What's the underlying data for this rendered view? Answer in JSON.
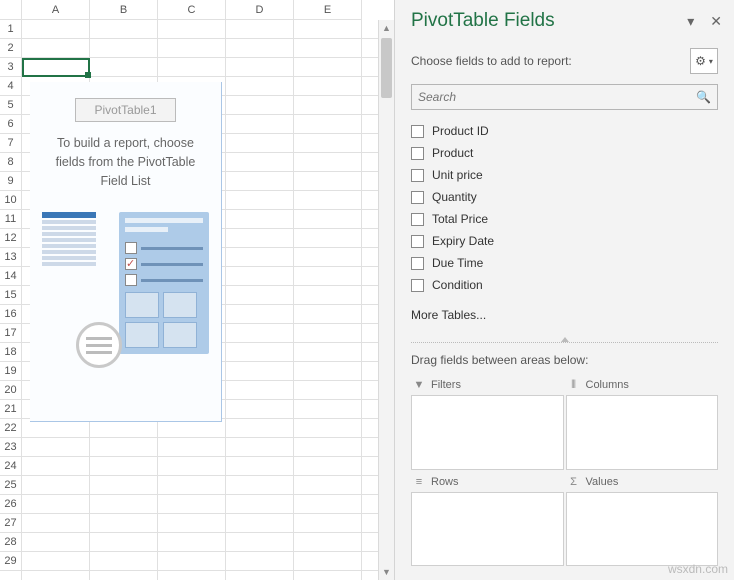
{
  "sheet": {
    "columns": [
      "A",
      "B",
      "C",
      "D",
      "E"
    ],
    "rows_visible": 29,
    "pivot": {
      "name": "PivotTable1",
      "hint": "To build a report, choose fields from the PivotTable Field List"
    }
  },
  "pane": {
    "title": "PivotTable Fields",
    "prompt": "Choose fields to add to report:",
    "search": {
      "placeholder": "Search"
    },
    "fields": [
      {
        "label": "Product ID"
      },
      {
        "label": "Product"
      },
      {
        "label": "Unit price"
      },
      {
        "label": "Quantity"
      },
      {
        "label": "Total Price"
      },
      {
        "label": "Expiry Date"
      },
      {
        "label": "Due Time"
      },
      {
        "label": "Condition"
      }
    ],
    "more": "More Tables...",
    "drag_hint": "Drag fields between areas below:",
    "areas": {
      "filters": "Filters",
      "columns": "Columns",
      "rows": "Rows",
      "values": "Values"
    }
  },
  "watermark": "wsxdn.com"
}
